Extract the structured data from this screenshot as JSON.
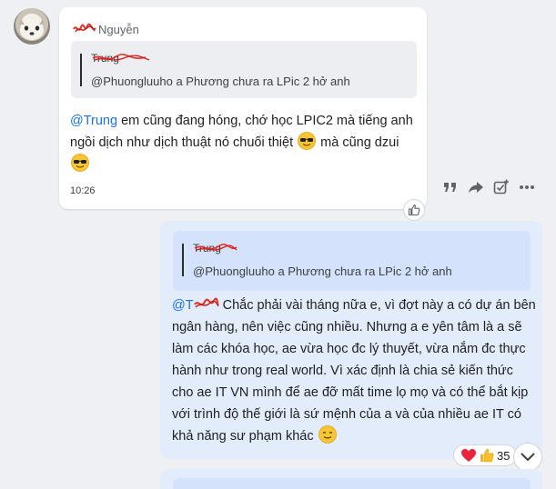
{
  "message1": {
    "sender": "Nguyễn",
    "quote": {
      "author": "Trung",
      "text": "@Phuongluuho a Phương chưa ra LPic 2 hở anh"
    },
    "mention": "@Trung",
    "text_part1": " em cũng đang hóng, chớ học LPIC2 mà tiếng anh ngồi dịch như dịch thuật nó chuối thiệt ",
    "text_part2": " mà cũng dzui ",
    "time": "10:26"
  },
  "toolbar": {
    "icons": [
      "quote-icon",
      "forward-icon",
      "add-task-icon",
      "more-icon"
    ]
  },
  "message2": {
    "quote": {
      "author": "Trung",
      "text": "@Phuongluuho a Phương chưa ra LPic 2 hở anh"
    },
    "mention": "@T",
    "text": " Chắc phải vài tháng nữa e, vì đợt này a có dự án bên ngân hàng, nên việc cũng nhiều. Nhưng a e yên tâm là a sẽ làm các khóa học, ae vừa học đc lý thuyết, vừa nắm đc thực hành như trong real world. Vì xác định là chia sẻ kiến thức cho ae IT VN mình để  ae đỡ mất time lọ mọ và có thể bắt kịp với trình độ thế giới là sứ mệnh của a và của nhiều ae IT có khả năng sư phạm khác "
  },
  "reactions": {
    "emojis": [
      "heart-emoji",
      "thumbs-up-emoji"
    ],
    "count": "35"
  },
  "colors": {
    "mention": "#1a73e8",
    "own_bubble": "#e3ecfb",
    "other_bubble": "#ffffff",
    "background": "#eef0f3"
  }
}
